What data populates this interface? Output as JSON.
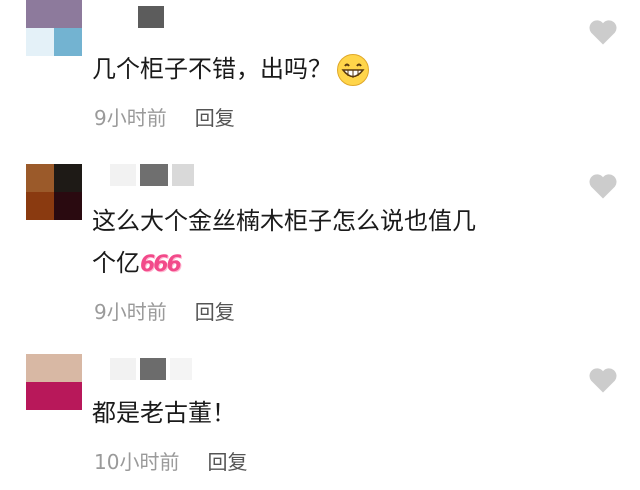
{
  "comments": [
    {
      "text": "几个柜子不错，出吗？",
      "time": "9小时前",
      "reply": "回复",
      "avatar_colors": [
        "#8d7a9c",
        "#ffffff",
        "#e4f1f8",
        "#73b3d1"
      ],
      "name_colors": [
        "#ffffff",
        "#5c5c5c"
      ],
      "emoji": "grinning-face"
    },
    {
      "text": "这么大个金丝楠木柜子怎么说也值几",
      "text2": "个亿",
      "badge": "666",
      "time": "9小时前",
      "reply": "回复",
      "avatar_colors": [
        "#9b5a2a",
        "#1e1a16",
        "#8a3a10",
        "#2a0a10"
      ],
      "name_colors": [
        "#f2f2f2",
        "#6f6f6f",
        "#d9d9d9"
      ]
    },
    {
      "text": "都是老古董！",
      "time": "10小时前",
      "reply": "回复",
      "avatar_colors": [
        "#d8b8a4",
        "#ffffff",
        "#b8185a",
        "#d8a0a8"
      ],
      "name_colors": [
        "#f2f2f2",
        "#6c6c6c",
        "#f4f4f4"
      ]
    }
  ],
  "heart_color": "#cccccc"
}
